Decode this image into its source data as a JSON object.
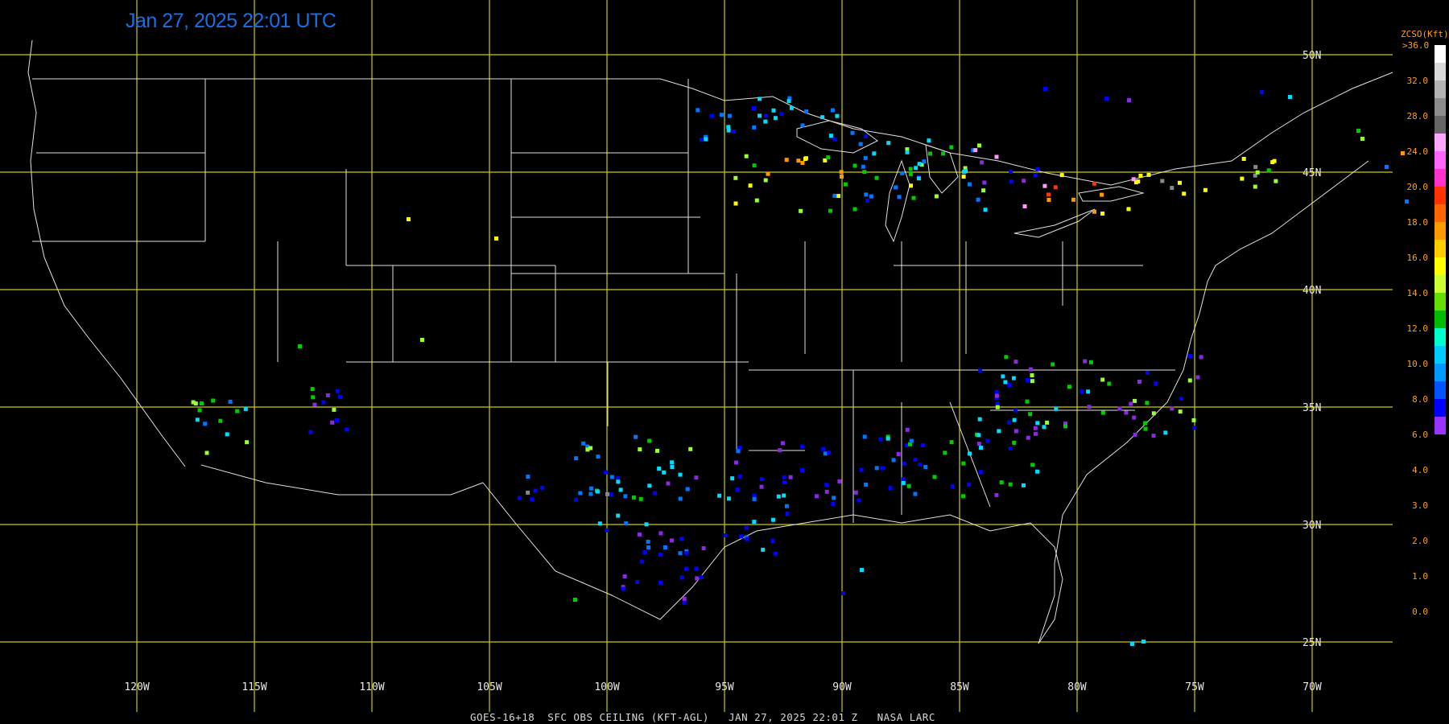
{
  "timestamp": "Jan 27, 2025 22:01 UTC",
  "caption": "GOES-16+18  SFC OBS CEILING (KFT-AGL)   JAN 27, 2025 22:01 Z   NASA LARC",
  "colorbar": {
    "title": "ZCSO(Kft)",
    "max_label": ">36.0",
    "ticks": [
      "32.0",
      "28.0",
      "24.0",
      "20.0",
      "18.0",
      "16.0",
      "14.0",
      "12.0",
      "10.0",
      "8.0",
      "6.0",
      "4.0",
      "3.0",
      "2.0",
      "1.0",
      "0.0"
    ],
    "colors": [
      "#ffffff",
      "#d9d9d9",
      "#b3b3b3",
      "#8c8c8c",
      "#666666",
      "#ffa6ff",
      "#ff66ff",
      "#ff33cc",
      "#ff3300",
      "#ff6600",
      "#ff9900",
      "#ffcc00",
      "#ffff00",
      "#ccff33",
      "#66dd00",
      "#00bb00",
      "#00ffcc",
      "#00ccff",
      "#0099ff",
      "#0055ff",
      "#0000ff",
      "#9933ff"
    ]
  },
  "latitude_labels": [
    "50N",
    "45N",
    "40N",
    "35N",
    "30N",
    "25N"
  ],
  "longitude_labels": [
    "120W",
    "115W",
    "110W",
    "105W",
    "100W",
    "95W",
    "90W",
    "85W",
    "80W",
    "75W",
    "70W"
  ],
  "grid_color": "#cccc00",
  "boundary_color": "#e0e0e0",
  "observation_categories": [
    {
      "name": "purple",
      "color": "#8a2be2",
      "ceiling": "0.0-1.0"
    },
    {
      "name": "blue",
      "color": "#0000ff",
      "ceiling": "1.0-2.0"
    },
    {
      "name": "azure",
      "color": "#0077ff",
      "ceiling": "2.0-4.0"
    },
    {
      "name": "cyan",
      "color": "#00ddff",
      "ceiling": "4.0-6.0"
    },
    {
      "name": "green",
      "color": "#00cc00",
      "ceiling": "6.0-8.0"
    },
    {
      "name": "lime",
      "color": "#99ff33",
      "ceiling": "8.0-10.0"
    },
    {
      "name": "yellow",
      "color": "#ffff00",
      "ceiling": "10.0-14.0"
    },
    {
      "name": "orange",
      "color": "#ff9900",
      "ceiling": "14.0-18.0"
    },
    {
      "name": "red",
      "color": "#ff3300",
      "ceiling": "16.0-18.0"
    },
    {
      "name": "pink",
      "color": "#ff99ff",
      "ceiling": "20.0-24.0"
    },
    {
      "name": "gray",
      "color": "#888888",
      "ceiling": "24.0-32.0"
    }
  ]
}
